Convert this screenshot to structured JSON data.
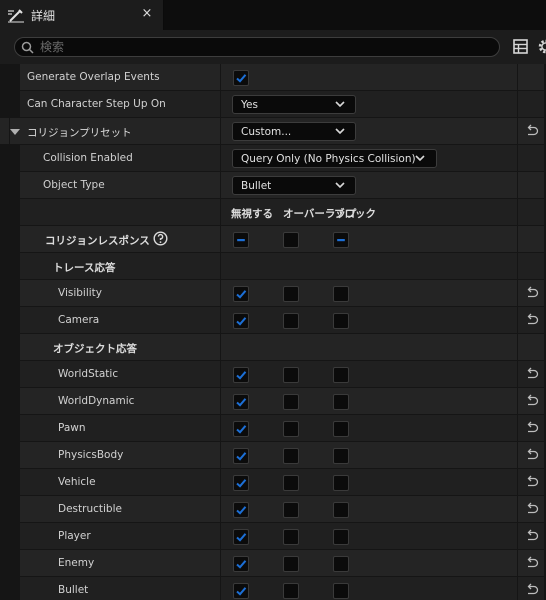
{
  "tab": {
    "title": "詳細",
    "close_glyph": "×",
    "icon": "pencil-icon"
  },
  "search": {
    "placeholder": "検索",
    "value": ""
  },
  "properties": {
    "generate_overlap_events": {
      "label": "Generate Overlap Events",
      "checked": true
    },
    "can_character_step_up_on": {
      "label": "Can Character Step Up On",
      "value": "Yes"
    },
    "collision_presets": {
      "label": "コリジョンプリセット",
      "value": "Custom...",
      "expanded": true
    },
    "collision_enabled": {
      "label": "Collision Enabled",
      "value": "Query Only (No Physics Collision)"
    },
    "object_type": {
      "label": "Object Type",
      "value": "Bullet"
    }
  },
  "response_columns": [
    "無視する",
    "オーバーラップ",
    "ブロック"
  ],
  "collision_responses": {
    "label": "コリジョンレスポンス",
    "values": [
      "mixed",
      "unchecked",
      "mixed"
    ]
  },
  "trace_responses": {
    "label": "トレース応答",
    "items": [
      {
        "label": "Visibility",
        "values": [
          true,
          false,
          false
        ]
      },
      {
        "label": "Camera",
        "values": [
          true,
          false,
          false
        ]
      }
    ]
  },
  "object_responses": {
    "label": "オブジェクト応答",
    "items": [
      {
        "label": "WorldStatic",
        "values": [
          true,
          false,
          false
        ]
      },
      {
        "label": "WorldDynamic",
        "values": [
          true,
          false,
          false
        ]
      },
      {
        "label": "Pawn",
        "values": [
          true,
          false,
          false
        ]
      },
      {
        "label": "PhysicsBody",
        "values": [
          true,
          false,
          false
        ]
      },
      {
        "label": "Vehicle",
        "values": [
          true,
          false,
          false
        ]
      },
      {
        "label": "Destructible",
        "values": [
          true,
          false,
          false
        ]
      },
      {
        "label": "Player",
        "values": [
          true,
          false,
          false
        ]
      },
      {
        "label": "Enemy",
        "values": [
          true,
          false,
          false
        ]
      },
      {
        "label": "Bullet",
        "values": [
          true,
          false,
          false
        ]
      }
    ]
  },
  "colors": {
    "accent": "#1c6fd6",
    "background": "#151515",
    "row": "#242424",
    "row_alt": "#202020"
  }
}
